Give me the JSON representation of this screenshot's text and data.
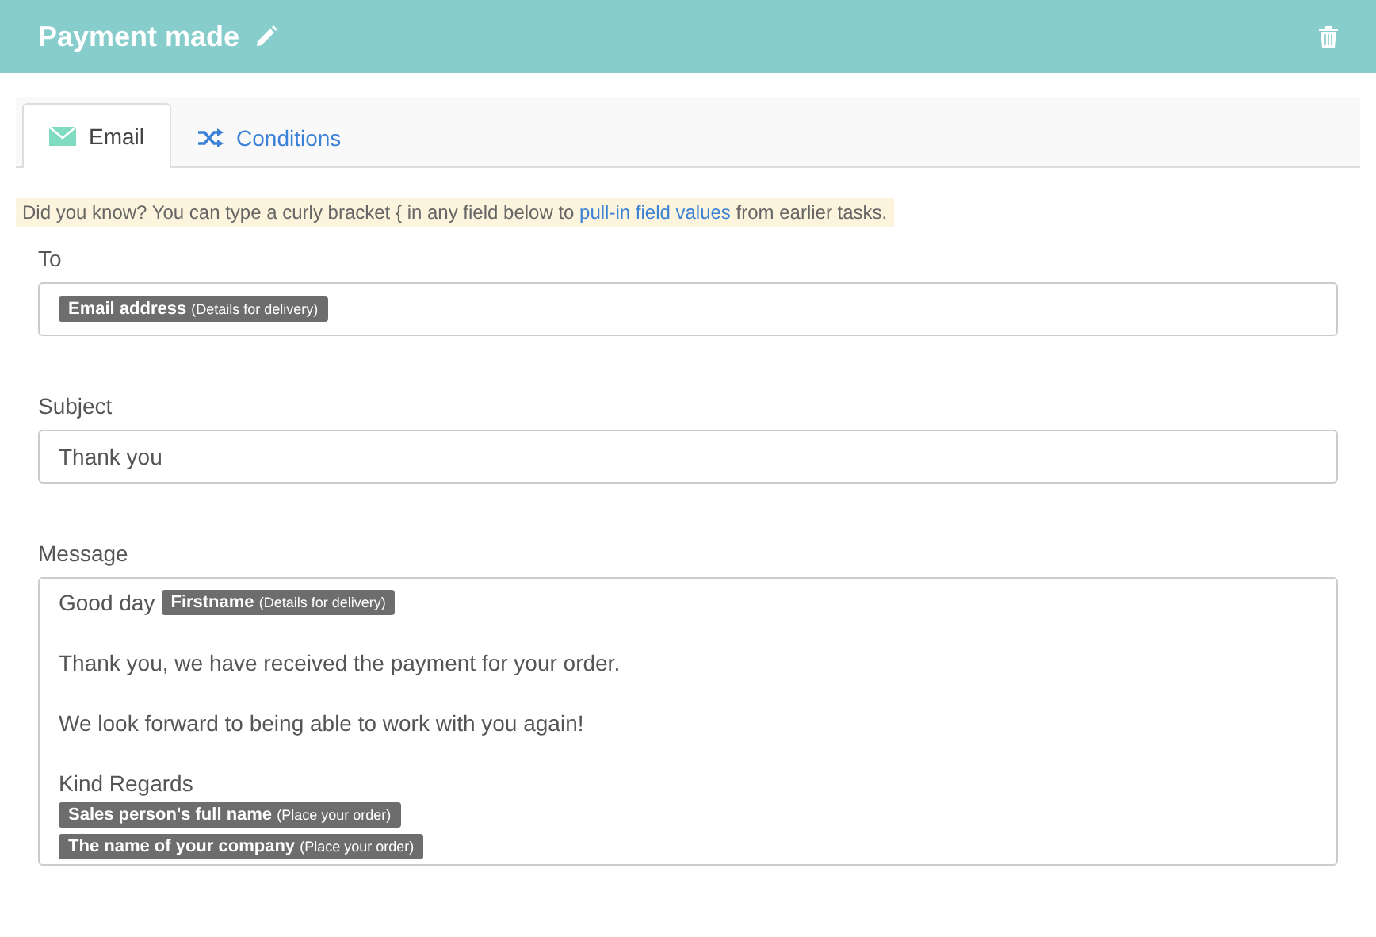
{
  "header": {
    "title": "Payment made"
  },
  "tabs": [
    {
      "label": "Email",
      "kind": "email",
      "selected": true
    },
    {
      "label": "Conditions",
      "kind": "conditions",
      "selected": false
    }
  ],
  "tip": {
    "before": "Did you know? You can type a curly bracket { in any field below to",
    "link": "pull-in field values",
    "after": "from earlier tasks."
  },
  "fields": [
    {
      "label": "To",
      "kind": "single",
      "paragraphs": [
        [
          [
            {
              "kind": "tag",
              "name": "Email address",
              "source": "(Details for delivery)"
            }
          ]
        ]
      ]
    },
    {
      "label": "Subject",
      "kind": "single",
      "paragraphs": [
        [
          [
            {
              "kind": "text",
              "text": "Thank you"
            }
          ]
        ]
      ]
    },
    {
      "label": "Message",
      "kind": "multi",
      "paragraphs": [
        [
          [
            {
              "kind": "text",
              "text": "Good day"
            },
            {
              "kind": "tag",
              "name": "Firstname",
              "source": "(Details for delivery)"
            }
          ]
        ],
        [
          [
            {
              "kind": "text",
              "text": "Thank you, we have received the payment for your order."
            }
          ]
        ],
        [
          [
            {
              "kind": "text",
              "text": "We look forward to being able to work with you again!"
            }
          ]
        ],
        [
          [
            {
              "kind": "text",
              "text": "Kind Regards"
            }
          ],
          [
            {
              "kind": "tag",
              "name": "Sales person's full name",
              "source": "(Place your order)"
            }
          ],
          [
            {
              "kind": "tag",
              "name": "The name of your company",
              "source": "(Place your order)"
            }
          ]
        ]
      ]
    }
  ]
}
